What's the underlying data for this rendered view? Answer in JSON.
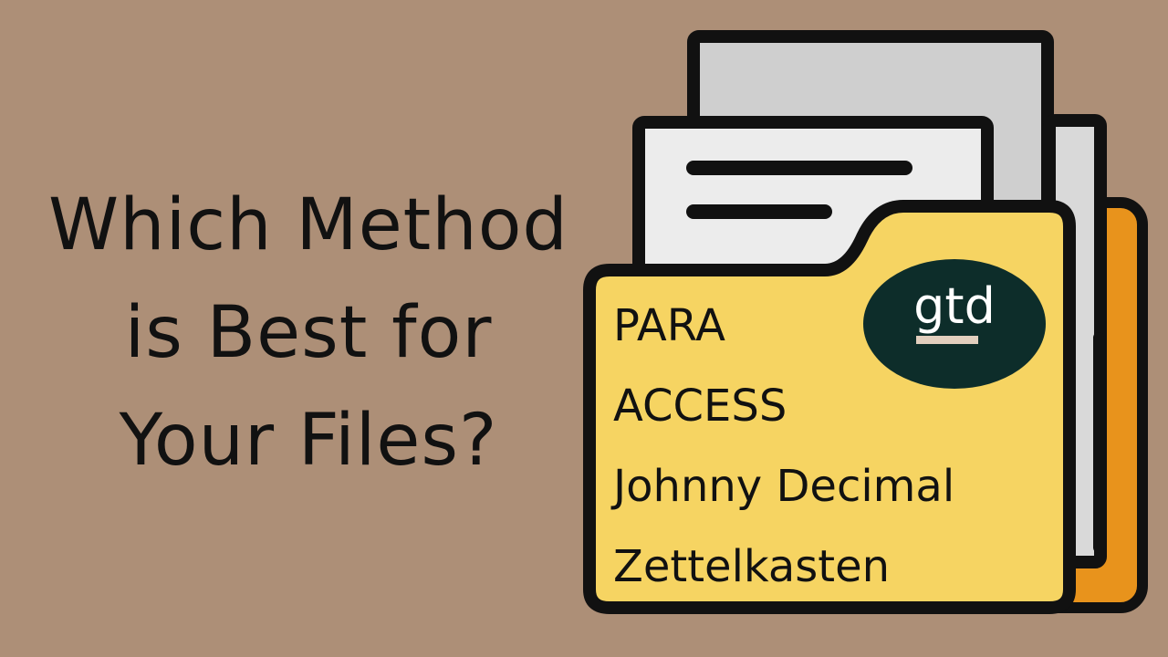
{
  "headline": {
    "line1": "Which Method",
    "line2": "is Best for",
    "line3": "Your Files?"
  },
  "folder": {
    "methods": [
      "PARA",
      "ACCESS",
      "Johnny Decimal",
      "Zettelkasten"
    ],
    "badge": "gtd"
  },
  "colors": {
    "background": "#ad8f77",
    "folder_front": "#f6d462",
    "folder_back": "#e8931c",
    "paper": "#dcdcdc",
    "outline": "#111111",
    "badge": "#0d2d2a"
  },
  "icons": [
    "folder-icon",
    "document-icon"
  ]
}
